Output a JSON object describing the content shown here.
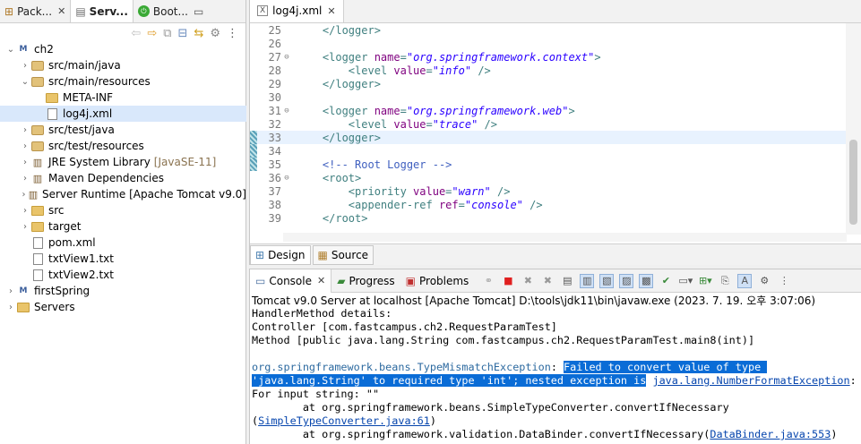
{
  "left_tabs": [
    {
      "label": "Pack...",
      "icon": "package-explorer-icon",
      "active": false
    },
    {
      "label": "Serv...",
      "icon": "servers-icon",
      "active": true
    },
    {
      "label": "Boot...",
      "icon": "boot-dashboard-icon",
      "active": false
    }
  ],
  "tree": [
    {
      "label": "ch2",
      "indent": 0,
      "twisty": "v",
      "icon": "project",
      "extra": ""
    },
    {
      "label": "src/main/java",
      "indent": 1,
      "twisty": ">",
      "icon": "pkgroot",
      "extra": ""
    },
    {
      "label": "src/main/resources",
      "indent": 1,
      "twisty": "v",
      "icon": "pkgroot",
      "extra": ""
    },
    {
      "label": "META-INF",
      "indent": 2,
      "twisty": "",
      "icon": "folder",
      "extra": ""
    },
    {
      "label": "log4j.xml",
      "indent": 2,
      "twisty": "",
      "icon": "xmlfile",
      "extra": "",
      "selected": true
    },
    {
      "label": "src/test/java",
      "indent": 1,
      "twisty": ">",
      "icon": "pkgroot",
      "extra": ""
    },
    {
      "label": "src/test/resources",
      "indent": 1,
      "twisty": ">",
      "icon": "pkgroot",
      "extra": ""
    },
    {
      "label": "JRE System Library",
      "indent": 1,
      "twisty": ">",
      "icon": "library",
      "extra": "[JavaSE-11]"
    },
    {
      "label": "Maven Dependencies",
      "indent": 1,
      "twisty": ">",
      "icon": "library",
      "extra": ""
    },
    {
      "label": "Server Runtime [Apache Tomcat v9.0]",
      "indent": 1,
      "twisty": ">",
      "icon": "library",
      "extra": ""
    },
    {
      "label": "src",
      "indent": 1,
      "twisty": ">",
      "icon": "srcfolder",
      "extra": ""
    },
    {
      "label": "target",
      "indent": 1,
      "twisty": ">",
      "icon": "folder",
      "extra": ""
    },
    {
      "label": "pom.xml",
      "indent": 1,
      "twisty": "",
      "icon": "pomfile",
      "extra": ""
    },
    {
      "label": "txtView1.txt",
      "indent": 1,
      "twisty": "",
      "icon": "file",
      "extra": ""
    },
    {
      "label": "txtView2.txt",
      "indent": 1,
      "twisty": "",
      "icon": "file",
      "extra": ""
    },
    {
      "label": "firstSpring",
      "indent": 0,
      "twisty": ">",
      "icon": "project",
      "extra": ""
    },
    {
      "label": "Servers",
      "indent": 0,
      "twisty": ">",
      "icon": "folder",
      "extra": ""
    }
  ],
  "editor": {
    "tab_label": "log4j.xml",
    "lines": [
      {
        "n": "25",
        "fold": "",
        "parts": [
          [
            "tg",
            "    </logger>"
          ]
        ],
        "mark": false,
        "cur": false
      },
      {
        "n": "26",
        "fold": "",
        "parts": [],
        "mark": false,
        "cur": false
      },
      {
        "n": "27",
        "fold": "⊖",
        "parts": [
          [
            "tg",
            "    <logger "
          ],
          [
            "at",
            "name"
          ],
          [
            "tg",
            "="
          ],
          [
            "av",
            "\"org.springframework.context\""
          ],
          [
            "tg",
            ">"
          ]
        ],
        "mark": false,
        "cur": false
      },
      {
        "n": "28",
        "fold": "",
        "parts": [
          [
            "tg",
            "        <level "
          ],
          [
            "at",
            "value"
          ],
          [
            "tg",
            "="
          ],
          [
            "av",
            "\"info\""
          ],
          [
            "tg",
            " />"
          ]
        ],
        "mark": false,
        "cur": false
      },
      {
        "n": "29",
        "fold": "",
        "parts": [
          [
            "tg",
            "    </logger>"
          ]
        ],
        "mark": false,
        "cur": false
      },
      {
        "n": "30",
        "fold": "",
        "parts": [],
        "mark": false,
        "cur": false
      },
      {
        "n": "31",
        "fold": "⊖",
        "parts": [
          [
            "tg",
            "    <logger "
          ],
          [
            "at",
            "name"
          ],
          [
            "tg",
            "="
          ],
          [
            "av",
            "\"org.springframework.web\""
          ],
          [
            "tg",
            ">"
          ]
        ],
        "mark": false,
        "cur": false
      },
      {
        "n": "32",
        "fold": "",
        "parts": [
          [
            "tg",
            "        <level "
          ],
          [
            "at",
            "value"
          ],
          [
            "tg",
            "="
          ],
          [
            "av",
            "\"trace\""
          ],
          [
            "tg",
            " />"
          ]
        ],
        "mark": false,
        "cur": false
      },
      {
        "n": "33",
        "fold": "",
        "parts": [
          [
            "tg",
            "    </logger>"
          ]
        ],
        "mark": true,
        "cur": true
      },
      {
        "n": "34",
        "fold": "",
        "parts": [],
        "mark": true,
        "cur": false
      },
      {
        "n": "35",
        "fold": "",
        "parts": [
          [
            "cm",
            "    <!-- Root Logger -->"
          ]
        ],
        "mark": true,
        "cur": false
      },
      {
        "n": "36",
        "fold": "⊖",
        "parts": [
          [
            "tg",
            "    <root>"
          ]
        ],
        "mark": false,
        "cur": false
      },
      {
        "n": "37",
        "fold": "",
        "parts": [
          [
            "tg",
            "        <priority "
          ],
          [
            "at",
            "value"
          ],
          [
            "tg",
            "="
          ],
          [
            "av",
            "\"warn\""
          ],
          [
            "tg",
            " />"
          ]
        ],
        "mark": false,
        "cur": false
      },
      {
        "n": "38",
        "fold": "",
        "parts": [
          [
            "tg",
            "        <appender-ref "
          ],
          [
            "at",
            "ref"
          ],
          [
            "tg",
            "="
          ],
          [
            "av",
            "\"console\""
          ],
          [
            "tg",
            " />"
          ]
        ],
        "mark": false,
        "cur": false
      },
      {
        "n": "39",
        "fold": "",
        "parts": [
          [
            "tg",
            "    </root>"
          ]
        ],
        "mark": false,
        "cur": false
      }
    ],
    "bottom_tabs": [
      {
        "label": "Design",
        "icon": "design-icon"
      },
      {
        "label": "Source",
        "icon": "source-icon"
      }
    ]
  },
  "console": {
    "tabs": [
      {
        "label": "Console",
        "icon": "console-icon",
        "active": true
      },
      {
        "label": "Progress",
        "icon": "progress-icon",
        "active": false
      },
      {
        "label": "Problems",
        "icon": "problems-icon",
        "active": false
      }
    ],
    "title": "Tomcat v9.0 Server at localhost [Apache Tomcat] D:\\tools\\jdk11\\bin\\javaw.exe  (2023. 7. 19. 오후 3:07:06)",
    "lines": [
      [
        [
          "t",
          "HandlerMethod details: "
        ]
      ],
      [
        [
          "t",
          "Controller [com.fastcampus.ch2.RequestParamTest]"
        ]
      ],
      [
        [
          "t",
          "Method [public java.lang.String com.fastcampus.ch2.RequestParamTest.main8(int)]"
        ]
      ],
      [
        [
          "t",
          " "
        ]
      ],
      [
        [
          "l2",
          "org.springframework.beans.TypeMismatchException"
        ],
        [
          "t",
          ": "
        ],
        [
          "h",
          "Failed to convert value of type "
        ]
      ],
      [
        [
          "h",
          "'java.lang.String' to required type 'int'; nested exception is"
        ],
        [
          "t",
          " "
        ],
        [
          "l",
          "java.lang.NumberFormatException"
        ],
        [
          "t",
          ":"
        ]
      ],
      [
        [
          "t",
          "For input string: \"\""
        ]
      ],
      [
        [
          "t",
          "        at org.springframework.beans.SimpleTypeConverter.convertIfNecessary"
        ]
      ],
      [
        [
          "t",
          "("
        ],
        [
          "l",
          "SimpleTypeConverter.java:61"
        ],
        [
          "t",
          ")"
        ]
      ],
      [
        [
          "t",
          "        at org.springframework.validation.DataBinder.convertIfNecessary("
        ],
        [
          "l",
          "DataBinder.java:553"
        ],
        [
          "t",
          ")"
        ]
      ]
    ]
  }
}
